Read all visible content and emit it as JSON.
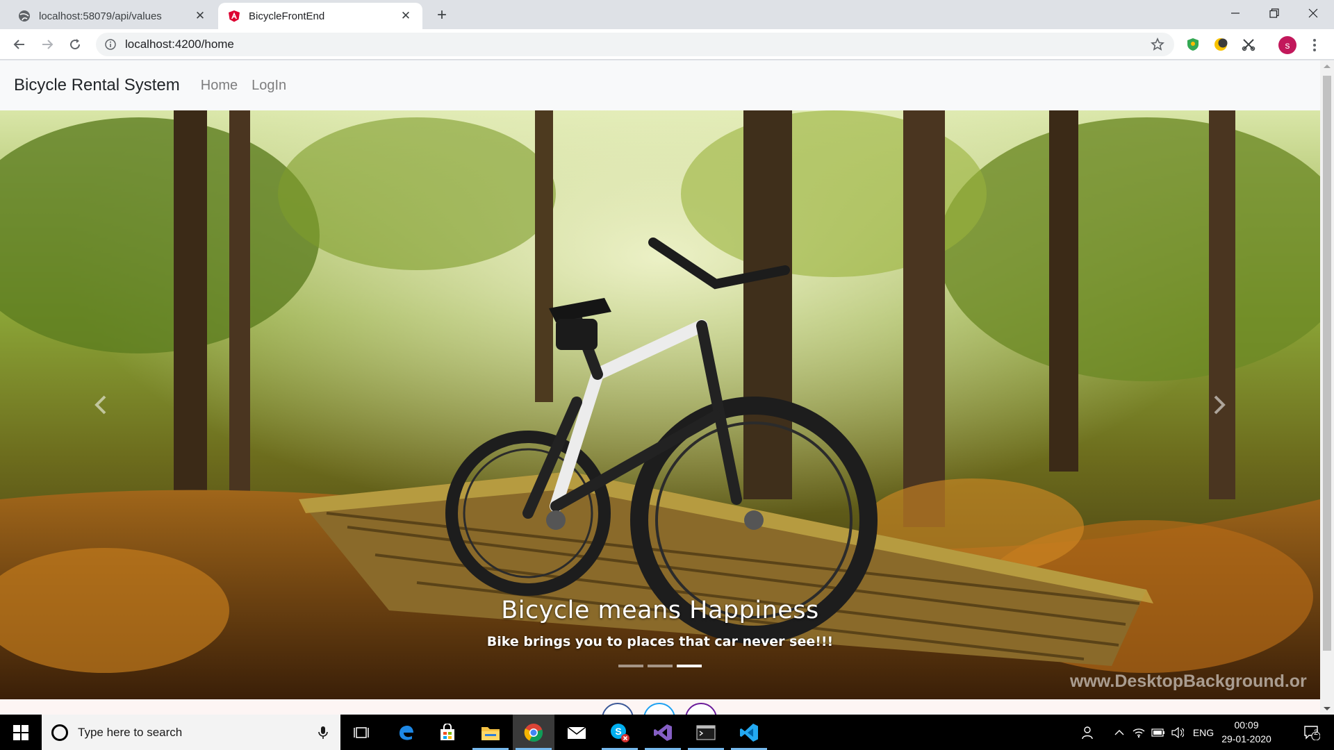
{
  "browser": {
    "tabs": [
      {
        "title": "localhost:58079/api/values",
        "icon": "globe-icon",
        "active": false
      },
      {
        "title": "BicycleFrontEnd",
        "icon": "angular-icon",
        "active": true
      }
    ],
    "address": "localhost:4200/home",
    "profile_initial": "s",
    "extensions": [
      "shield-extension-icon",
      "moon-extension-icon",
      "scissors-extension-icon"
    ]
  },
  "app": {
    "brand": "Bicycle Rental System",
    "nav": [
      "Home",
      "LogIn"
    ]
  },
  "carousel": {
    "caption_title": "Bicycle means Happiness",
    "caption_text": "Bike brings you to places that car never see!!!",
    "slide_count": 3,
    "active_index": 2,
    "watermark": "www.DesktopBackground.or"
  },
  "taskbar": {
    "search_placeholder": "Type here to search",
    "pinned": [
      "task-view-icon",
      "edge-icon",
      "store-icon",
      "file-explorer-icon",
      "chrome-icon",
      "mail-icon",
      "skype-icon",
      "visual-studio-icon",
      "terminal-icon",
      "vscode-icon"
    ],
    "language": "ENG",
    "time": "00:09",
    "date": "29-01-2020",
    "notification_count": "2"
  },
  "colors": {
    "accent_taskbar": "#76b9ed",
    "profile": "#c2185b",
    "navbar_bg": "#f8f9fa"
  }
}
